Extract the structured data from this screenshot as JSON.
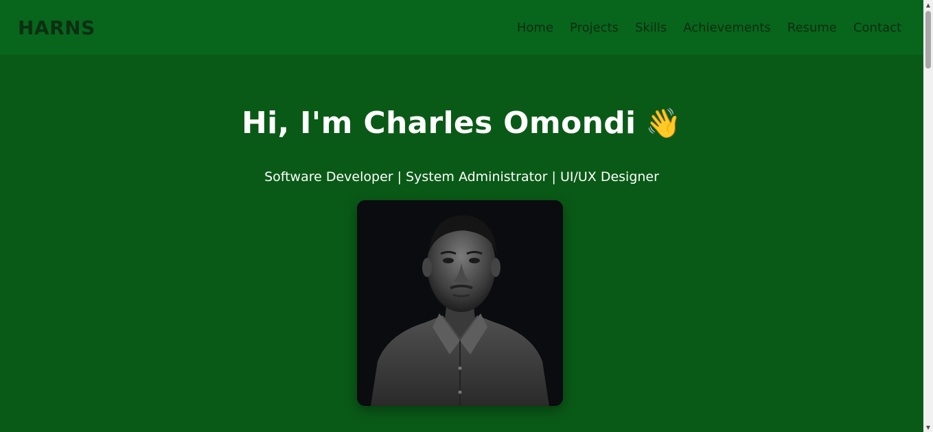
{
  "header": {
    "brand": "HARNS",
    "nav": [
      {
        "label": "Home"
      },
      {
        "label": "Projects"
      },
      {
        "label": "Skills"
      },
      {
        "label": "Achievements"
      },
      {
        "label": "Resume"
      },
      {
        "label": "Contact"
      }
    ]
  },
  "hero": {
    "title": "Hi, I'm Charles Omondi",
    "wave_emoji": "👋",
    "subtitle": "Software Developer | System Administrator | UI/UX Designer",
    "photo_icon": "profile-photo"
  },
  "colors": {
    "nav_bg": "#07661c",
    "hero_bg": "#0a5a17",
    "brand_text": "#0c2f12",
    "nav_text": "#0d2b11",
    "hero_text": "#ffffff"
  }
}
